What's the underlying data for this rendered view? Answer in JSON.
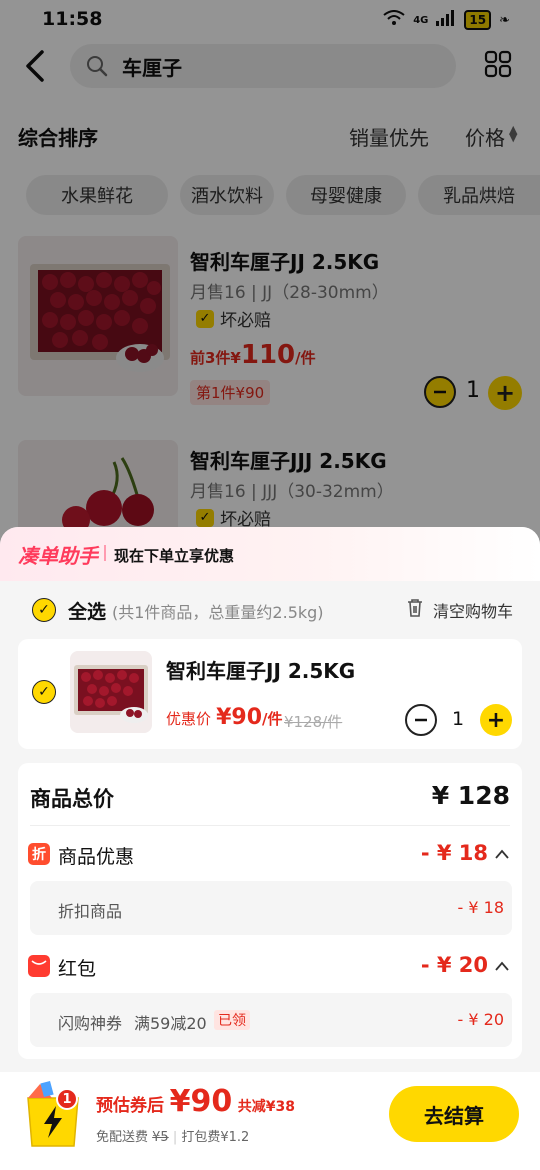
{
  "status_bar": {
    "time": "11:58",
    "network": "4G",
    "battery": "15"
  },
  "search": {
    "query": "车厘子"
  },
  "sort": {
    "main": "综合排序",
    "sales": "销量优先",
    "price": "价格"
  },
  "categories": [
    "水果鲜花",
    "酒水饮料",
    "母婴健康",
    "乳品烘焙"
  ],
  "products": [
    {
      "title": "智利车厘子JJ 2.5KG",
      "meta": "月售16 | JJ（28-30mm）",
      "badge": "坏必赔",
      "price_prefix": "前3件¥",
      "price": "110",
      "price_unit": "/件",
      "tag": "第1件¥90",
      "qty": "1"
    },
    {
      "title": "智利车厘子JJJ 2.5KG",
      "meta": "月售16 | JJJ（30-32mm）",
      "badge": "坏必赔"
    }
  ],
  "cart": {
    "assistant_brand": "凑单助手",
    "assistant_tip": "现在下单立享优惠",
    "select_all": "全选",
    "select_summary": "(共1件商品，总重量约2.5kg)",
    "clear_cart": "清空购物车",
    "item": {
      "title": "智利车厘子JJ 2.5KG",
      "price_label": "优惠价",
      "price": "¥90",
      "price_unit": "/件",
      "original_price": "¥128/件",
      "qty": "1"
    },
    "total_label": "商品总价",
    "total_value": "¥ 128",
    "discount": {
      "icon": "折",
      "label": "商品优惠",
      "value": "- ¥ 18",
      "sub_label": "折扣商品",
      "sub_value": "- ¥ 18"
    },
    "redpacket": {
      "label": "红包",
      "value": "- ¥ 20",
      "sub_label": "闪购神券",
      "sub_condition": "满59减20",
      "sub_status": "已领",
      "sub_value": "- ¥ 20"
    }
  },
  "footer": {
    "cart_count": "1",
    "estimate_label": "预估券后",
    "estimate_price": "¥90",
    "total_saving": "共减¥38",
    "shipping_free": "免配送费",
    "shipping_original": "¥5",
    "packing": "打包费¥1.2",
    "checkout": "去结算"
  },
  "colors": {
    "accent": "#ffd800",
    "price_red": "#e4291c",
    "brand_pink": "#ff3b5c"
  }
}
